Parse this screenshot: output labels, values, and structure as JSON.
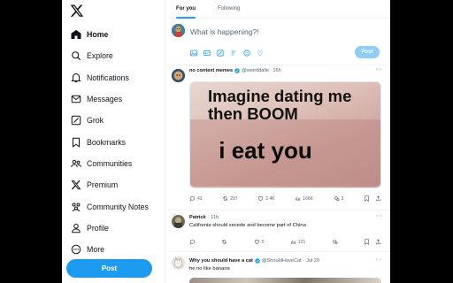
{
  "sidebar": {
    "logo_icon": "x-logo-icon",
    "items": [
      {
        "label": "Home",
        "icon": "home-icon"
      },
      {
        "label": "Explore",
        "icon": "search-icon"
      },
      {
        "label": "Notifications",
        "icon": "bell-icon"
      },
      {
        "label": "Messages",
        "icon": "envelope-icon"
      },
      {
        "label": "Grok",
        "icon": "grok-icon"
      },
      {
        "label": "Bookmarks",
        "icon": "bookmark-icon"
      },
      {
        "label": "Communities",
        "icon": "people-icon"
      },
      {
        "label": "Premium",
        "icon": "x-logo-icon"
      },
      {
        "label": "Community Notes",
        "icon": "community-notes-icon"
      },
      {
        "label": "Profile",
        "icon": "person-icon"
      },
      {
        "label": "More",
        "icon": "more-circle-icon"
      }
    ],
    "post_label": "Post"
  },
  "tabs": [
    {
      "label": "For you",
      "active": true
    },
    {
      "label": "Following",
      "active": false
    }
  ],
  "composer": {
    "placeholder": "What is happening?!",
    "post_label": "Post"
  },
  "tweets": [
    {
      "name": "no context memes",
      "handle": "@weirddalle",
      "time": "· 16h",
      "media_caption_top": "Imagine dating me then BOOM",
      "media_caption_line1": "Imagine dating me",
      "media_caption_line2": "then BOOM",
      "media_caption_bottom": "i eat you",
      "replies": "43",
      "reposts": "297",
      "likes": "2.4K",
      "views": "166K",
      "grok_count": "3"
    },
    {
      "name": "Patrick",
      "handle": "",
      "time": "· 11h",
      "text": "California should secede and become part of China",
      "replies": "",
      "reposts": "",
      "likes": "5",
      "views": "121"
    },
    {
      "name": "Why you should have a cat",
      "handle": "@ShouldHaveCat",
      "time": "· Jul 20",
      "text": "he no like banana"
    }
  ],
  "colors": {
    "accent": "#1d9bf0",
    "text": "#0f1419",
    "muted": "#536471"
  }
}
